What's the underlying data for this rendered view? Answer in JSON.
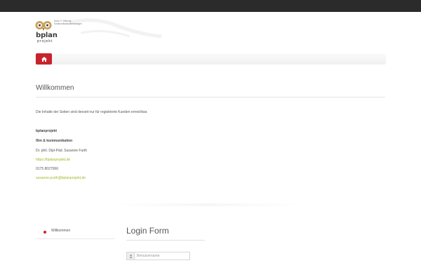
{
  "brand": {
    "tagline_line1": "Dubs. P. Wiebuig",
    "tagline_line2": "Kommunikationsberatungen",
    "name": "bplan",
    "sub": "projekt",
    "accent": "#c8232c"
  },
  "nav": {
    "home_icon": "home-icon"
  },
  "article": {
    "title": "Willkommen",
    "intro": "Die Inhalte der Seiten sind derzeit nur für registrierte Kunden erreichbar.",
    "contact": {
      "company": "bplanprojekt",
      "division": "film & kommunikation",
      "person": "Dr. phil. Dipl-Päd. Susanne Furth",
      "website": "https://bplanprojekt.de",
      "phone": "0175 8027066",
      "email": "susanne.purth@bplanprojekt.de"
    },
    "link_color": "#a8b52a"
  },
  "sidebar": {
    "items": [
      {
        "label": "Willkommen"
      }
    ]
  },
  "login": {
    "title": "Login Form",
    "username_placeholder": "Benutzername",
    "user_icon": "user-icon"
  }
}
